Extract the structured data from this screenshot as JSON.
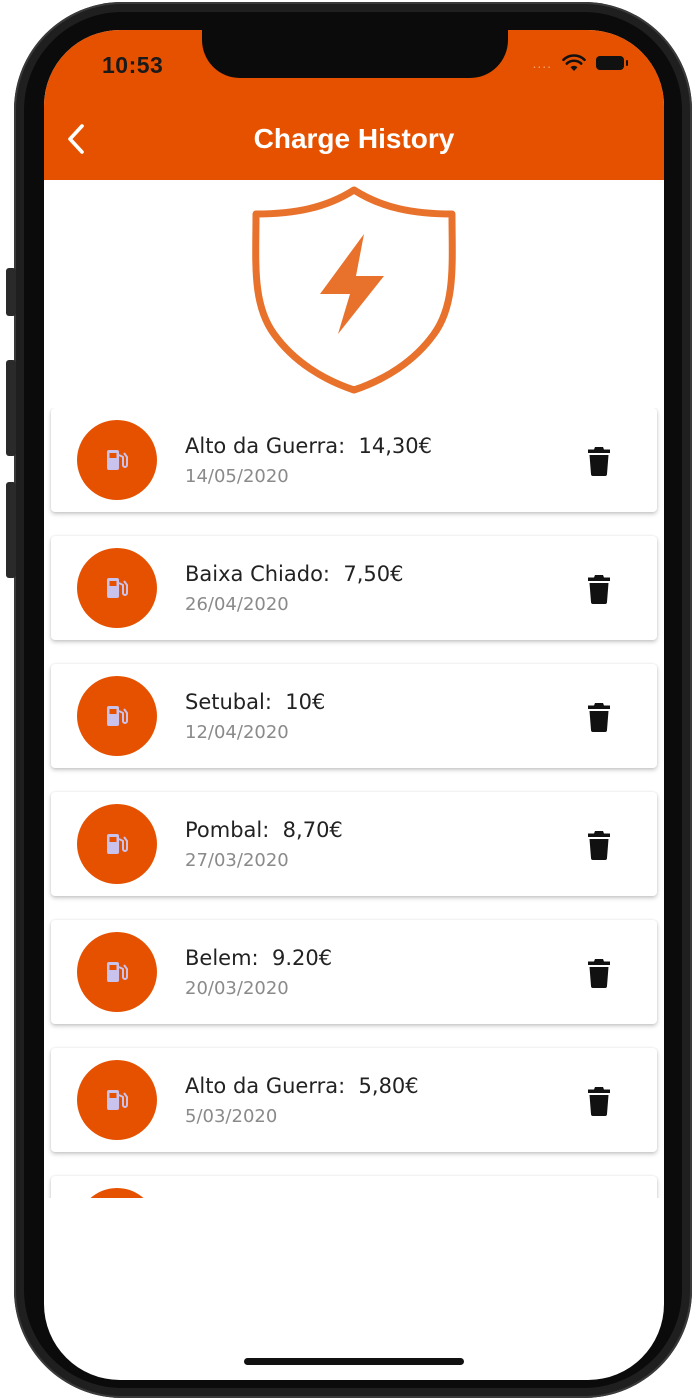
{
  "status_bar": {
    "time": "10:53",
    "signal": "....",
    "icons": [
      "wifi-icon",
      "battery-icon"
    ]
  },
  "app_bar": {
    "title": "Charge History",
    "back_icon": "chevron-left-icon",
    "color": "#e65100"
  },
  "logo": {
    "icon": "shield-lightning-icon",
    "color": "#e8712b"
  },
  "charges": [
    {
      "location": "Alto da Guerra",
      "amount": "14,30€",
      "label": "Alto da Guerra:  14,30€",
      "date": "14/05/2020"
    },
    {
      "location": "Baixa Chiado",
      "amount": "7,50€",
      "label": "Baixa Chiado:  7,50€",
      "date": "26/04/2020"
    },
    {
      "location": "Setubal",
      "amount": "10€",
      "label": "Setubal:  10€",
      "date": "12/04/2020"
    },
    {
      "location": "Pombal",
      "amount": "8,70€",
      "label": "Pombal:  8,70€",
      "date": "27/03/2020"
    },
    {
      "location": "Belem",
      "amount": "9.20€",
      "label": "Belem:  9.20€",
      "date": "20/03/2020"
    },
    {
      "location": "Alto da Guerra",
      "amount": "5,80€",
      "label": "Alto da Guerra:  5,80€",
      "date": "5/03/2020"
    }
  ],
  "item_icons": {
    "leading": "fuel-station-icon",
    "trailing": "trash-icon",
    "leading_bg": "#e65100",
    "leading_fg": "#c9c2ec"
  }
}
